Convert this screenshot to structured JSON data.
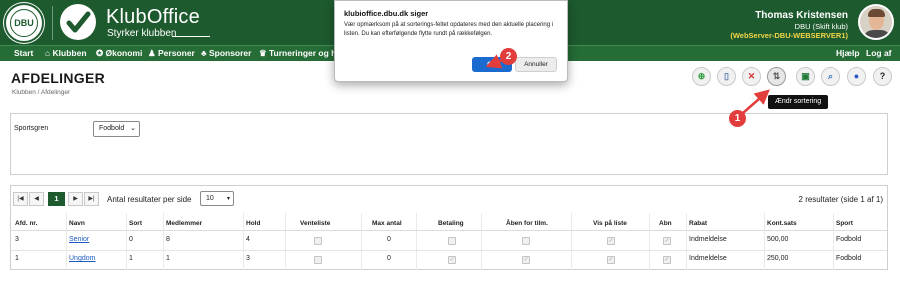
{
  "header": {
    "seal_text": "DBU",
    "brand_name": "KlubOffice",
    "brand_tagline": "Styrker klubben",
    "user_name": "Thomas Kristensen",
    "user_club": "DBU (Skift klub)",
    "user_server": "(WebServer-DBU-WEBSERVER1)"
  },
  "nav": {
    "items": [
      "Start",
      "Klubben",
      "Økonomi",
      "Personer",
      "Sponsorer",
      "Turneringer og hol"
    ],
    "help": "Hjælp",
    "logout": "Log af"
  },
  "page": {
    "title": "AFDELINGER",
    "breadcrumb": "Klubben / Afdelinger"
  },
  "toolbar": {
    "tooltip": "Ændr sortering",
    "help_label": "?"
  },
  "filter": {
    "sport_label": "Sportsgren",
    "sport_value": "Fodbold"
  },
  "grid": {
    "current_page": "1",
    "per_page_label": "Antal resultater per side",
    "per_page_value": "10",
    "summary": "2 resultater (side 1 af 1)",
    "columns": [
      "Afd. nr.",
      "Navn",
      "Sort",
      "Medlemmer",
      "Hold",
      "Venteliste",
      "Max antal",
      "Betaling",
      "Åben for tilm.",
      "Vis på liste",
      "Abn",
      "Rabat",
      "Kont.sats",
      "Sport"
    ],
    "rows": [
      {
        "afd_nr": "3",
        "navn": "Senior",
        "sort": "0",
        "medlemmer": "8",
        "hold": "4",
        "venteliste": false,
        "max_antal": "0",
        "betaling": false,
        "aaben": false,
        "vis_paa_liste": true,
        "abn": true,
        "rabat": "Indmeldelse",
        "kont_sats": "500,00",
        "sport": "Fodbold"
      },
      {
        "afd_nr": "1",
        "navn": "Ungdom",
        "sort": "1",
        "medlemmer": "1",
        "hold": "3",
        "venteliste": false,
        "max_antal": "0",
        "betaling": true,
        "aaben": true,
        "vis_paa_liste": true,
        "abn": true,
        "rabat": "Indmeldelse",
        "kont_sats": "250,00",
        "sport": "Fodbold"
      }
    ]
  },
  "dialog": {
    "title": "klubioffice.dbu.dk siger",
    "message": "Vær opmærksom på at sorterings-feltet opdateres med den aktuelle placering i listen. Du kan efterfølgende flytte rundt på rækkefølgen.",
    "ok_label": "OK",
    "cancel_label": "Annuller"
  },
  "annotations": {
    "marker_1": "1",
    "marker_2": "2"
  },
  "colors": {
    "header_bg": "#1d5a2e",
    "nav_bg": "#256c36",
    "server_text": "#f3d54a",
    "primary_button": "#1b6ad0",
    "annotation_red": "#e23d3d"
  }
}
